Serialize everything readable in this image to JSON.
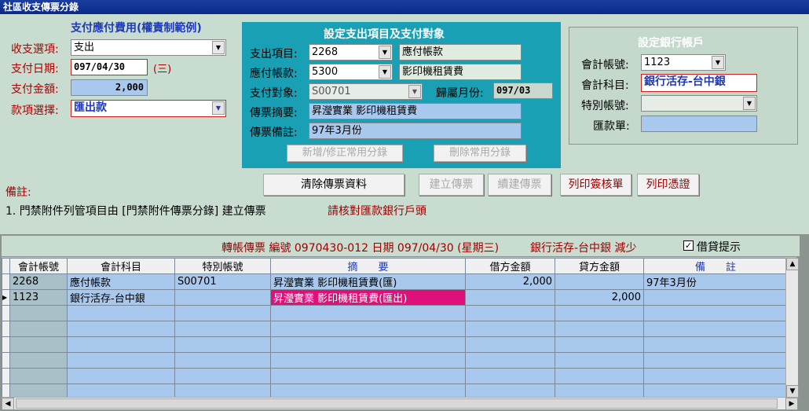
{
  "window": {
    "title": "社區收支傳票分錄"
  },
  "left": {
    "heading": "支付應付費用(權責制範例)",
    "type_label": "收支選項:",
    "type_value": "支出",
    "date_label": "支付日期:",
    "date_value": "097/04/30",
    "weekday": "(三)",
    "amount_label": "支付金額:",
    "amount_value": "2,000",
    "method_label": "款項選擇:",
    "method_value": "匯出款"
  },
  "middle": {
    "heading": "設定支出項目及支付對象",
    "item_label": "支出項目:",
    "item_code": "2268",
    "item_name": "應付帳款",
    "payable_label": "應付帳款:",
    "payable_code": "5300",
    "payable_name": "影印機租賃費",
    "payee_label": "支付對象:",
    "payee_code": "S00701",
    "month_label": "歸屬月份:",
    "month_value": "097/03",
    "summary_label": "傳票摘要:",
    "summary_value": "昇瀅實業 影印機租賃費",
    "note_label": "傳票備註:",
    "note_value": "97年3月份",
    "btn_add": "新增/修正常用分錄",
    "btn_delete": "刪除常用分錄"
  },
  "right": {
    "heading": "設定銀行帳戶",
    "account_no_label": "會計帳號:",
    "account_no_value": "1123",
    "account_name_label": "會計科目:",
    "account_name_value": "銀行活存-台中銀",
    "special_label": "特別帳號:",
    "special_value": "",
    "remit_label": "匯款單:",
    "remit_value": ""
  },
  "actions": {
    "clear": "清除傳票資料",
    "create": "建立傳票",
    "continue": "續建傳票",
    "print_approve": "列印簽核單",
    "print_voucher": "列印憑證"
  },
  "notes": {
    "label": "備註:",
    "line1": "1. 門禁附件列管項目由 [門禁附件傳票分錄] 建立傳票",
    "warning": "請核對匯款銀行戶頭"
  },
  "voucher_header": {
    "text": "轉帳傳票 編號 0970430-012 日期 097/04/30 (星期三)",
    "bank_text": "銀行活存-台中銀 減少",
    "checkbox_label": "借貸提示",
    "checkbox_checked": true
  },
  "grid": {
    "columns": [
      "會計帳號",
      "會計科目",
      "特別帳號",
      "摘　　要",
      "借方金額",
      "貸方金額",
      "備　　註"
    ],
    "rows": [
      [
        "2268",
        "應付帳款",
        "S00701",
        "昇瀅實業 影印機租賃費(匯)",
        "2,000",
        "",
        "97年3月份"
      ],
      [
        "1123",
        "銀行活存-台中銀",
        "",
        "昇瀅實業 影印機租賃費(匯出)",
        "",
        "2,000",
        ""
      ]
    ]
  },
  "colors": {
    "titlebar": "#0a2a88",
    "panel_teal": "#1aa0b4",
    "label_red": "#b00000",
    "grid_row": "#a9c8ee",
    "highlight": "#e0107a"
  }
}
